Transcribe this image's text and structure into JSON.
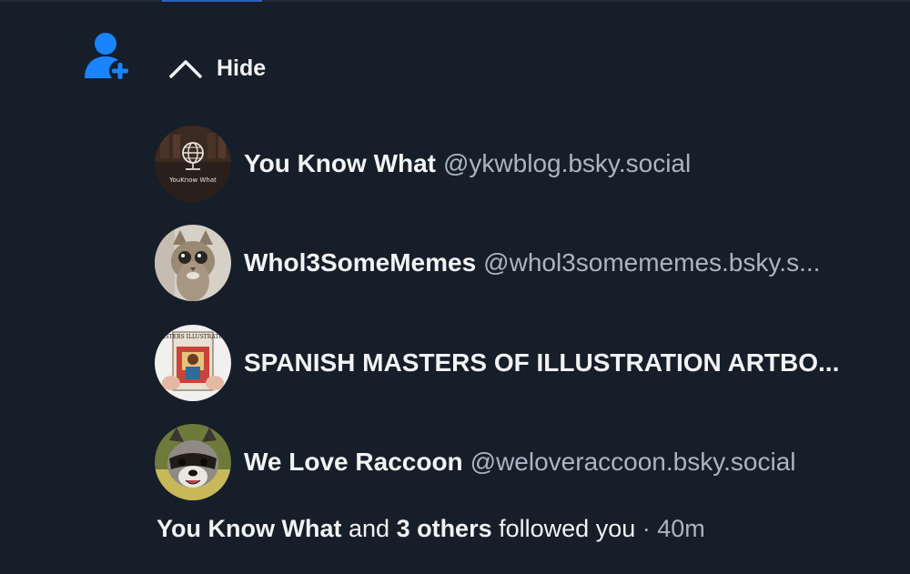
{
  "colors": {
    "background": "#161e29",
    "accent": "#1a83ff",
    "text_primary": "#f1f3f5",
    "text_secondary": "#aab5c3"
  },
  "header": {
    "icon": "person-add-icon",
    "toggle_icon": "chevron-up-icon",
    "toggle_label": "Hide"
  },
  "users": [
    {
      "display_name": "You Know What",
      "handle": "@ykwblog.bsky.social",
      "avatar_caption": "YouKnow What"
    },
    {
      "display_name": "Whol3SomeMemes",
      "handle": "@whol3somememes.bsky.s..."
    },
    {
      "display_name": "SPANISH MASTERS OF ILLUSTRATION ARTBO...",
      "handle": "",
      "avatar_caption": "MASTERS ILLUSTRATION"
    },
    {
      "display_name": "We Love Raccoon",
      "handle": "@weloveraccoon.bsky.social"
    }
  ],
  "summary": {
    "first_name": "You Know What",
    "and_text": "and",
    "others": "3 others",
    "action": "followed you",
    "separator": "·",
    "time": "40m"
  }
}
